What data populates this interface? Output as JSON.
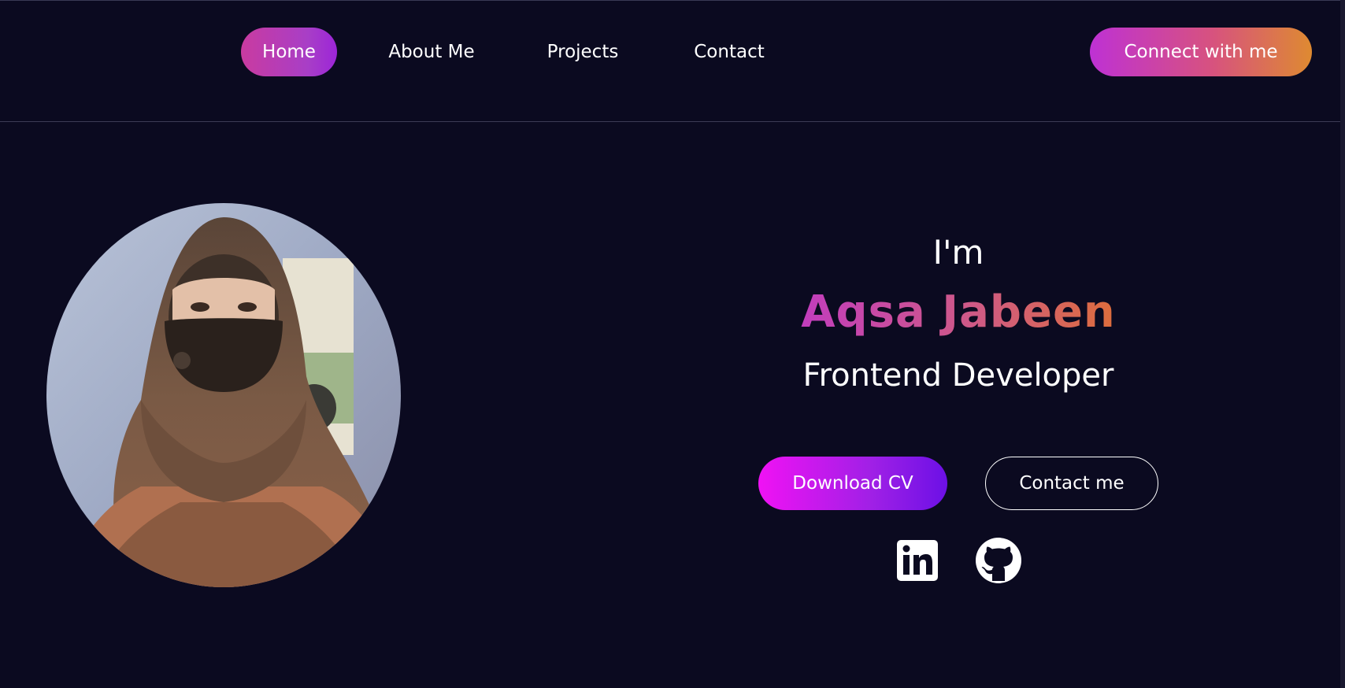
{
  "nav": {
    "items": [
      {
        "label": "Home",
        "active": true
      },
      {
        "label": "About Me",
        "active": false
      },
      {
        "label": "Projects",
        "active": false
      },
      {
        "label": "Contact",
        "active": false
      }
    ],
    "cta_label": "Connect with me"
  },
  "hero": {
    "intro": "I'm",
    "name": "Aqsa Jabeen",
    "role": "Frontend Developer",
    "download_label": "Download CV",
    "contact_label": "Contact me",
    "social": [
      {
        "icon": "linkedin-icon"
      },
      {
        "icon": "github-icon"
      }
    ]
  },
  "colors": {
    "background": "#0b0a20",
    "accent_pink": "#c93ba0",
    "accent_purple": "#9c25d8",
    "accent_orange": "#de8a31",
    "magenta": "#f012f4"
  }
}
